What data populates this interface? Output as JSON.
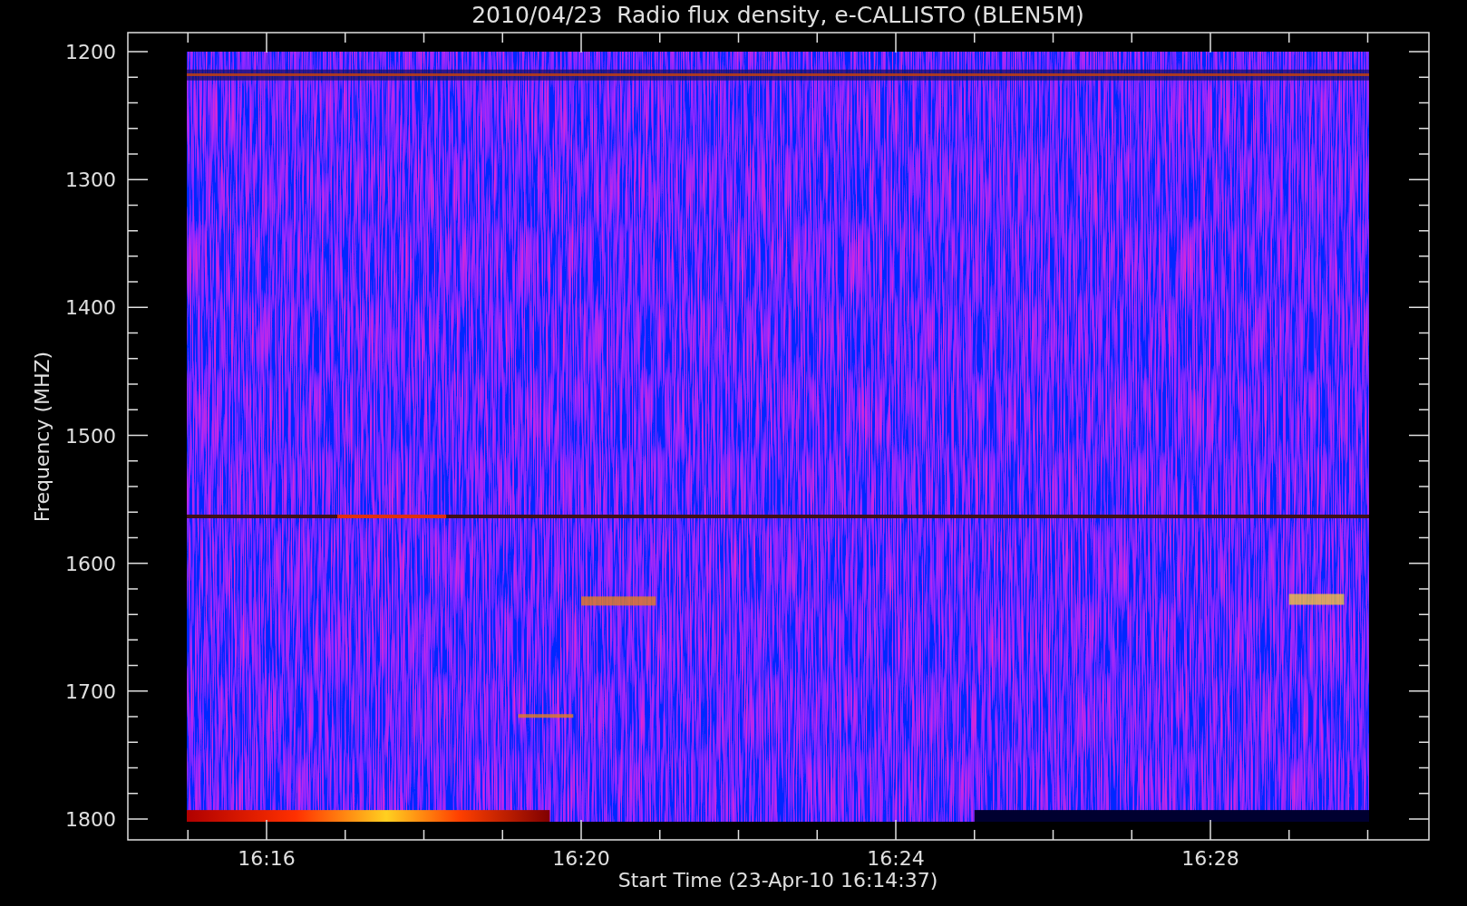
{
  "title": "2010/04/23  Radio flux density, e-CALLISTO (BLEN5M)",
  "y_axis": {
    "label": "Frequency (MHZ)",
    "ticks": [
      "1200",
      "1300",
      "1400",
      "1500",
      "1600",
      "1700",
      "1800"
    ]
  },
  "x_axis": {
    "label": "Start Time (23-Apr-10 16:14:37)",
    "ticks": [
      "16:16",
      "16:20",
      "16:24",
      "16:28"
    ]
  }
}
